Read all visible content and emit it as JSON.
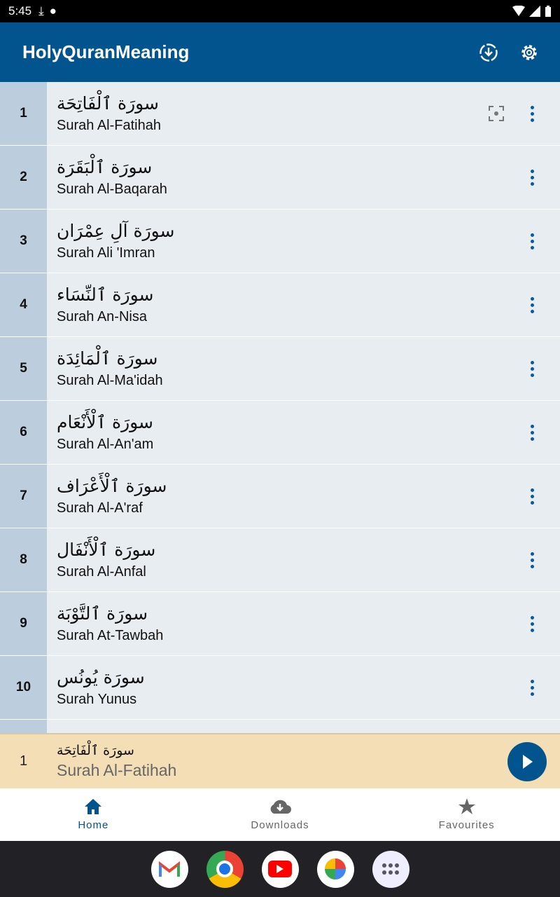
{
  "status": {
    "time": "5:45"
  },
  "appbar": {
    "title": "HolyQuranMeaning",
    "icons": [
      "download-circle-icon",
      "gear-icon"
    ]
  },
  "surahs": [
    {
      "num": "1",
      "ar": "سورَة ٱلْفَاتِحَة",
      "en": "Surah Al-Fatihah",
      "focus": true
    },
    {
      "num": "2",
      "ar": "سورَة ٱلْبَقَرَة",
      "en": "Surah Al-Baqarah"
    },
    {
      "num": "3",
      "ar": "سورَة آلِ عِمْرَان",
      "en": "Surah Ali 'Imran"
    },
    {
      "num": "4",
      "ar": "سورَة ٱلنِّسَاء",
      "en": "Surah An-Nisa"
    },
    {
      "num": "5",
      "ar": "سورَة ٱلْمَائِدَة",
      "en": "Surah Al-Ma'idah"
    },
    {
      "num": "6",
      "ar": "سورَة ٱلْأَنْعَام",
      "en": "Surah Al-An'am"
    },
    {
      "num": "7",
      "ar": "سورَة ٱلْأَعْرَاف",
      "en": "Surah Al-A'raf"
    },
    {
      "num": "8",
      "ar": "سورَة ٱلْأَنْفَال",
      "en": "Surah Al-Anfal"
    },
    {
      "num": "9",
      "ar": "سورَة ٱلتَّوْبَة",
      "en": "Surah At-Tawbah"
    },
    {
      "num": "10",
      "ar": "سورَة يُونُس",
      "en": "Surah Yunus"
    }
  ],
  "player": {
    "num": "1",
    "ar": "سورَة ٱلْفَاتِحَة",
    "en": "Surah Al-Fatihah",
    "icon": "play-icon"
  },
  "nav": {
    "tabs": [
      {
        "label": "Home",
        "icon": "home-icon",
        "active": true
      },
      {
        "label": "Downloads",
        "icon": "cloud-download-icon"
      },
      {
        "label": "Favourites",
        "icon": "star-icon"
      }
    ]
  },
  "dock": [
    "gmail-icon",
    "chrome-icon",
    "youtube-icon",
    "photos-icon",
    "app-drawer-icon"
  ],
  "colors": {
    "primary": "#02548f",
    "number_cell": "#bccddd",
    "row_bg": "#e8edf2",
    "player_bg": "#f3deb5"
  }
}
